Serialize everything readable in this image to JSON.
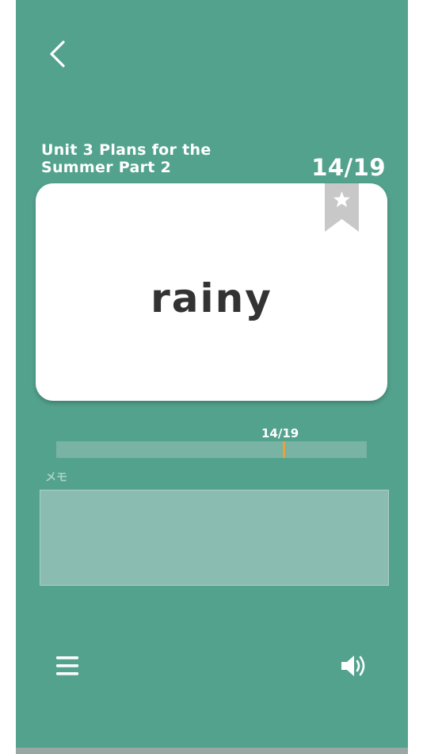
{
  "header": {
    "back_icon": "chevron-left-icon",
    "deck_title": "Unit 3 Plans for the Summer Part 2",
    "counter": "14/19"
  },
  "card": {
    "word": "rainy",
    "bookmark_icon": "star-bookmark-icon"
  },
  "progress": {
    "label": "14/19",
    "current": 14,
    "total": 19,
    "marker_color": "#e6a23c"
  },
  "memo": {
    "label": "メモ",
    "value": ""
  },
  "footer": {
    "menu_icon": "hamburger-menu-icon",
    "sound_icon": "speaker-icon"
  },
  "colors": {
    "background": "#53a28d",
    "card": "#ffffff",
    "progress_track": "#78b3a4",
    "memo_box": "#8bbcb2"
  }
}
